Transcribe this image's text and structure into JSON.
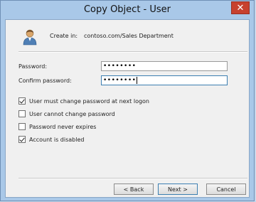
{
  "window": {
    "title": "Copy Object - User",
    "close_glyph": "✕"
  },
  "header": {
    "create_in_label": "Create in:",
    "create_in_value": "contoso.com/Sales Department",
    "icon": "user-icon"
  },
  "form": {
    "password_label": "Password:",
    "password_value": "••••••••",
    "confirm_label": "Confirm password:",
    "confirm_value": "••••••••"
  },
  "options": [
    {
      "label": "User must change password at next logon",
      "checked": true
    },
    {
      "label": "User cannot change password",
      "checked": false
    },
    {
      "label": "Password never expires",
      "checked": false
    },
    {
      "label": "Account is disabled",
      "checked": true
    }
  ],
  "buttons": {
    "back": "< Back",
    "next": "Next >",
    "cancel": "Cancel"
  }
}
